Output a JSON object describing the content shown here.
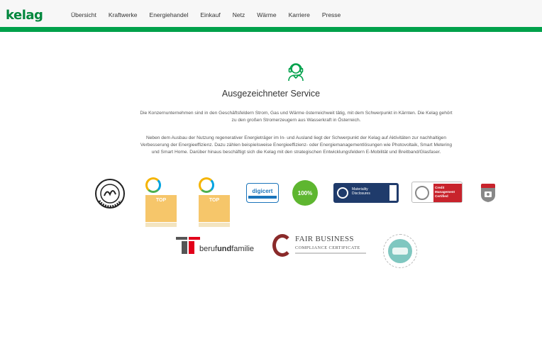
{
  "header": {
    "logo": "kelag",
    "nav": [
      "Übersicht",
      "Kraftwerke",
      "Energiehandel",
      "Einkauf",
      "Netz",
      "Wärme",
      "Karriere",
      "Presse"
    ]
  },
  "main": {
    "heading": "Ausgezeichneter Service",
    "paragraphs": [
      "Die Konzernunternehmen sind in den Geschäftsfeldern Strom, Gas und Wärme österreichweit tätig, mit dem Schwerpunkt in Kärnten. Die Kelag gehört zu den großen Stromerzeugern aus Wasserkraft in Österreich.",
      "Neben dem Ausbau der Nutzung regenerativer Energieträger im In- und Ausland liegt der Schwerpunkt der Kelag auf Aktivitäten zur nachhaltigen Verbesserung der Energieeffizienz. Dazu zählen beispielsweise Energieeffizienz- oder Energiemanagementlösungen wie Photovoltaik, Smart Metering und Smart Home. Darüber hinaus beschäftigt sich die Kelag mit den strategischen Entwicklungsfeldern E-Mobilität und Breitband/Glasfaser."
    ]
  },
  "badges": {
    "ci1": {
      "top": "TOP"
    },
    "ci2": {
      "top": "TOP"
    },
    "digicert": {
      "name": "digicert"
    },
    "green100": {
      "num": "100%"
    },
    "materiality": {
      "line1": "Materiality",
      "line2": "Disclosures"
    },
    "credit": {
      "line1": "Credit",
      "line2": "Management",
      "line3": "Certified"
    },
    "beruf": {
      "part1": "beruf",
      "part2": "und",
      "part3": "familie"
    },
    "fair": {
      "title": "FAIR BUSINESS",
      "sub": "COMPLIANCE CERTIFICATE"
    }
  },
  "colors": {
    "brand_green": "#00a14b",
    "logo_green": "#00873d"
  }
}
